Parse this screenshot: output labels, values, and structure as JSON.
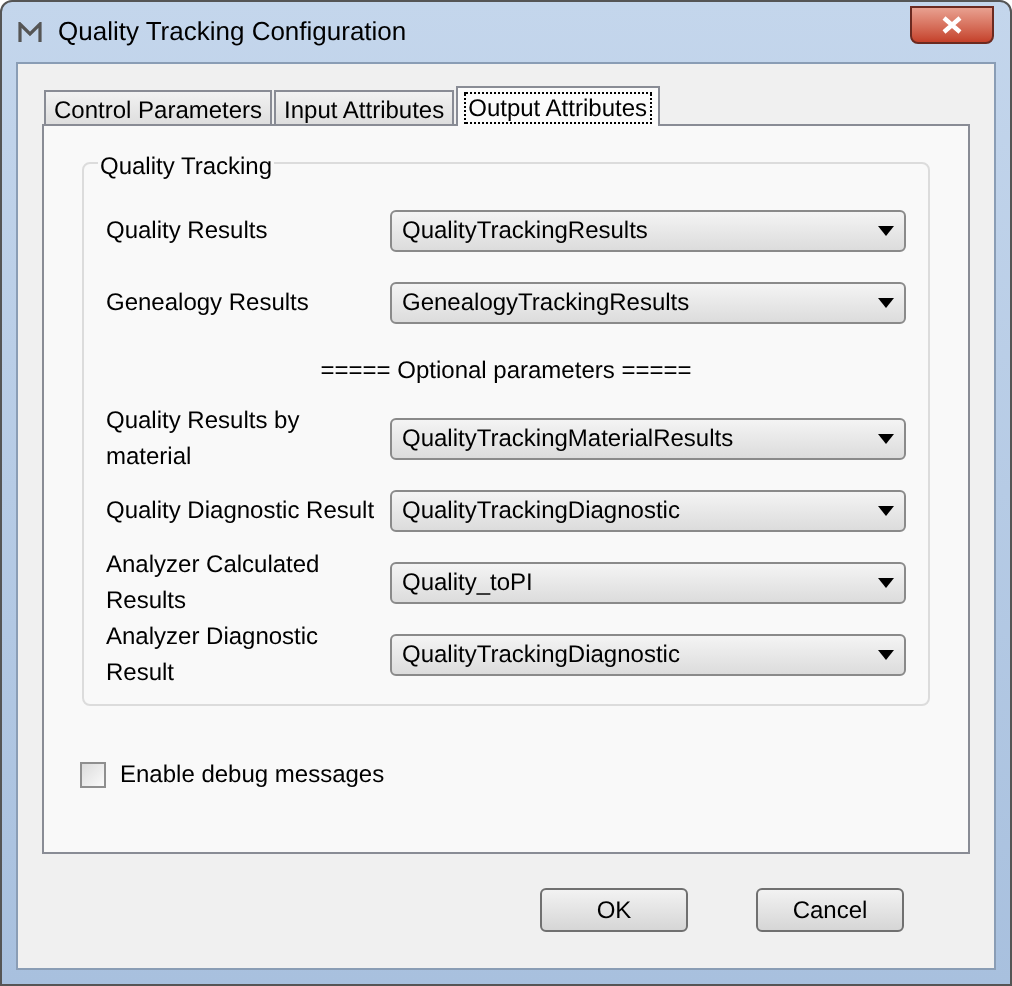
{
  "window": {
    "title": "Quality Tracking Configuration"
  },
  "tabs": [
    {
      "label": "Control Parameters",
      "selected": false
    },
    {
      "label": "Input Attributes",
      "selected": false
    },
    {
      "label": "Output Attributes",
      "selected": true
    }
  ],
  "group": {
    "title": "Quality Tracking",
    "rows": [
      {
        "kind": "field",
        "label": "Quality Results",
        "value": "QualityTrackingResults"
      },
      {
        "kind": "field",
        "label": "Genealogy Results",
        "value": "GenealogyTrackingResults"
      },
      {
        "kind": "heading",
        "label": "===== Optional parameters ====="
      },
      {
        "kind": "field",
        "label": "Quality Results by material",
        "value": "QualityTrackingMaterialResults"
      },
      {
        "kind": "field",
        "label": "Quality Diagnostic Result",
        "value": "QualityTrackingDiagnostic"
      },
      {
        "kind": "field",
        "label": "Analyzer Calculated Results",
        "value": "Quality_toPI"
      },
      {
        "kind": "field",
        "label": "Analyzer Diagnostic Result",
        "value": "QualityTrackingDiagnostic"
      }
    ]
  },
  "debug": {
    "label": "Enable debug messages",
    "checked": false
  },
  "buttons": [
    "OK",
    "Cancel"
  ]
}
